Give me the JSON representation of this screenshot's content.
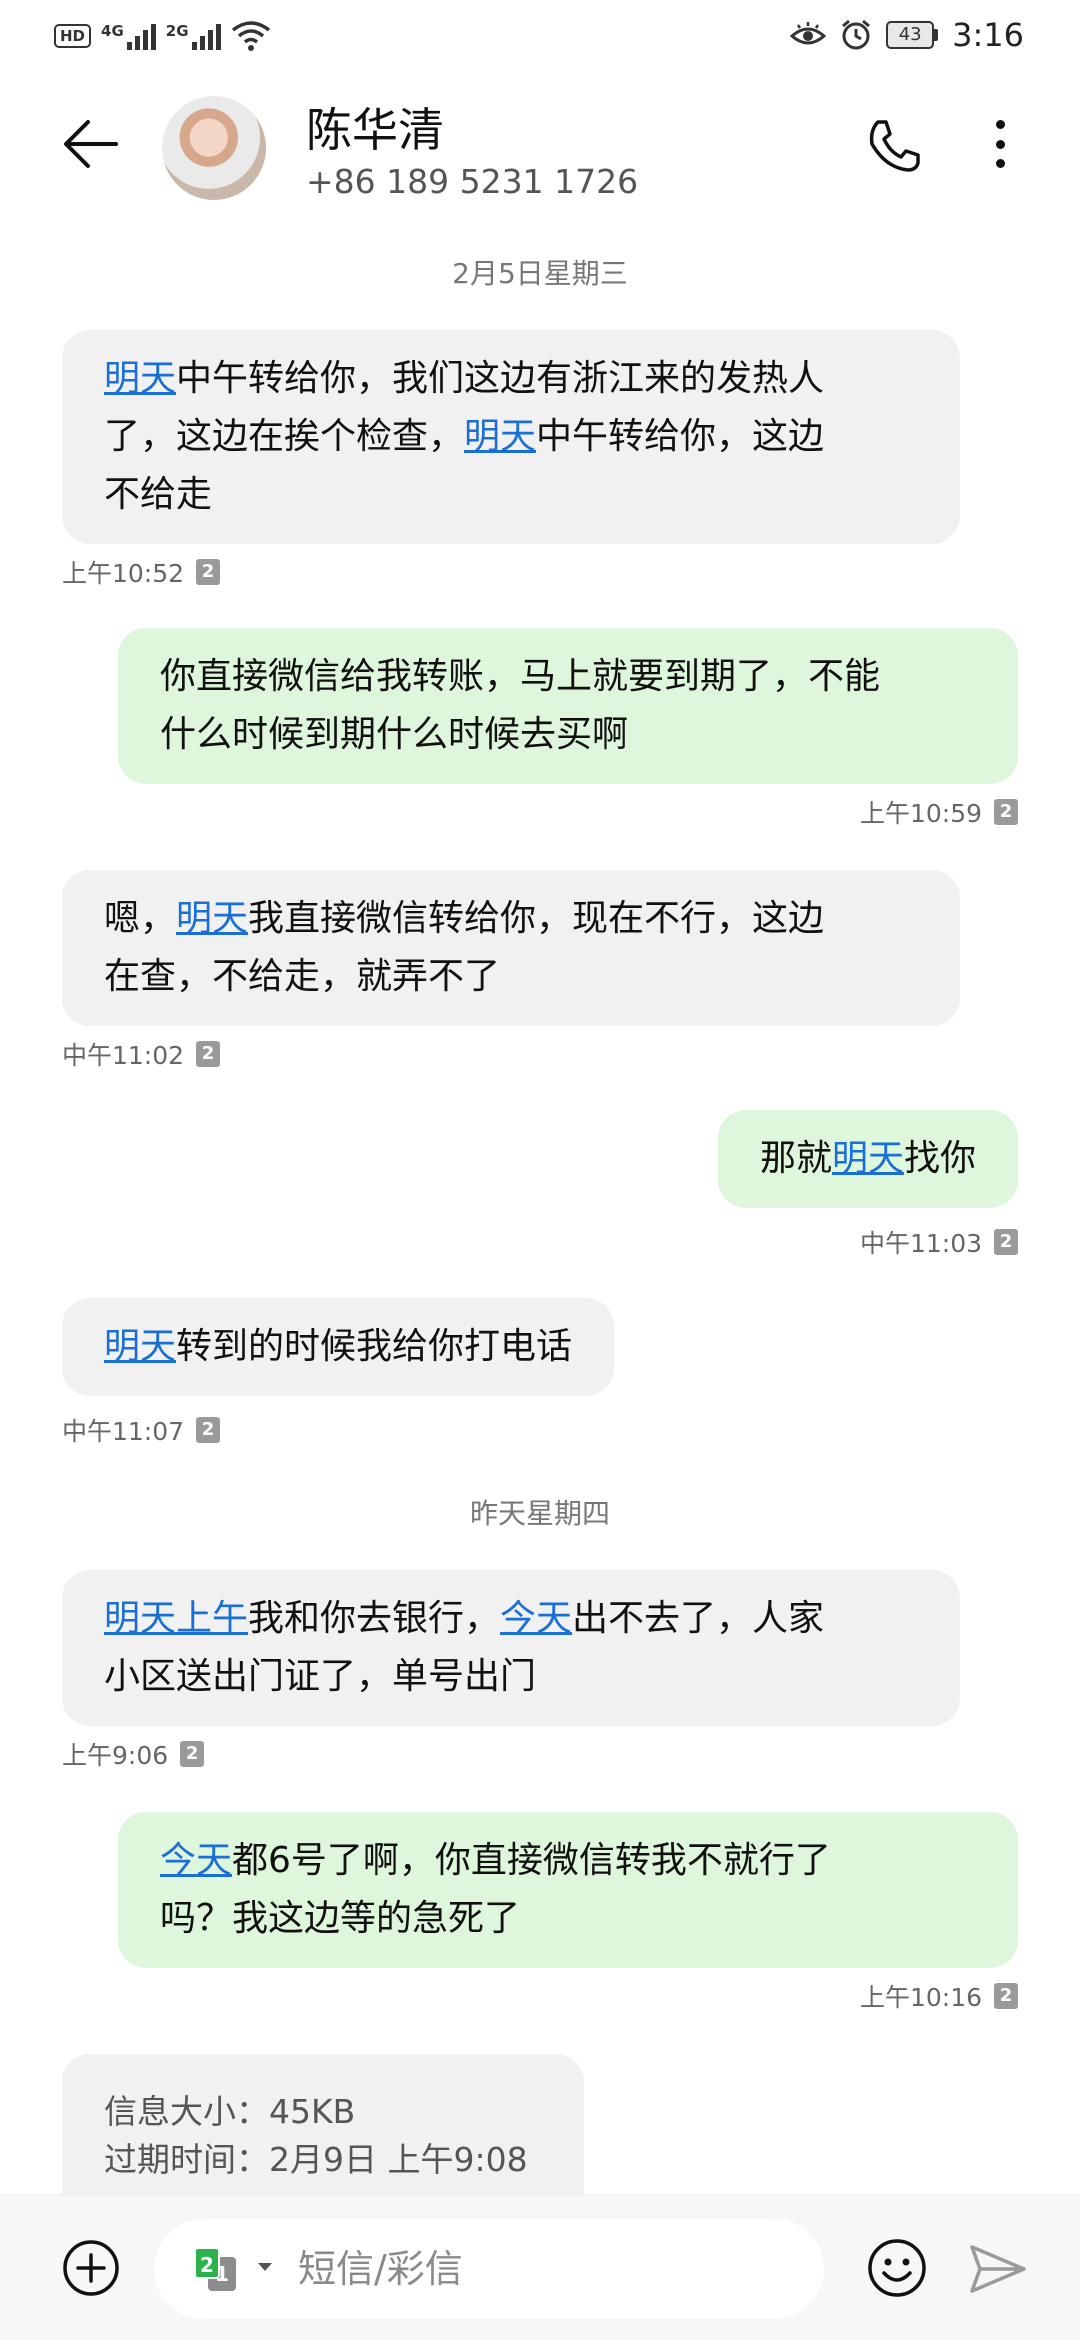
{
  "status_bar": {
    "hd": "HD",
    "net1": "4G",
    "net2": "2G",
    "battery": "43",
    "time": "3:16"
  },
  "header": {
    "name": "陈华清",
    "phone": "+86 189 5231 1726"
  },
  "conversation": {
    "date1": "2月5日星期三",
    "date2": "昨天星期四",
    "sim_label": "2",
    "messages": [
      {
        "dir": "in",
        "time": "上午10:52",
        "parts": [
          [
            "明天",
            true
          ],
          [
            "中午转给你，我们这边有浙江来的发热人",
            false
          ],
          [
            "\n",
            false
          ],
          [
            "了，这边在挨个检查，",
            false
          ],
          [
            "明天",
            true
          ],
          [
            "中午转给你，这边",
            false
          ],
          [
            "\n",
            false
          ],
          [
            "不给走",
            false
          ]
        ]
      },
      {
        "dir": "out",
        "time": "上午10:59",
        "parts": [
          [
            "你直接微信给我转账，马上就要到期了，不能",
            false
          ],
          [
            "\n",
            false
          ],
          [
            "什么时候到期什么时候去买啊",
            false
          ]
        ]
      },
      {
        "dir": "in",
        "time": "中午11:02",
        "parts": [
          [
            "嗯，",
            false
          ],
          [
            "明天",
            true
          ],
          [
            "我直接微信转给你，现在不行，这边",
            false
          ],
          [
            "\n",
            false
          ],
          [
            "在查，不给走，就弄不了",
            false
          ]
        ]
      },
      {
        "dir": "out",
        "time": "中午11:03",
        "parts": [
          [
            "那就",
            false
          ],
          [
            "明天",
            true
          ],
          [
            "找你",
            false
          ]
        ]
      },
      {
        "dir": "in",
        "time": "中午11:07",
        "parts": [
          [
            "明天",
            true
          ],
          [
            "转到的时候我给你打电话",
            false
          ]
        ]
      },
      {
        "dir": "in",
        "time": "上午9:06",
        "parts": [
          [
            "明天上午",
            true
          ],
          [
            "我和你去银行，",
            false
          ],
          [
            "今天",
            true
          ],
          [
            "出不去了，人家",
            false
          ],
          [
            "\n",
            false
          ],
          [
            "小区送出门证了，单号出门",
            false
          ]
        ]
      },
      {
        "dir": "out",
        "time": "上午10:16",
        "parts": [
          [
            "今天",
            true
          ],
          [
            "都6号了啊，你直接微信转我不就行了",
            false
          ],
          [
            "\n",
            false
          ],
          [
            "吗？我这边等的急死了",
            false
          ]
        ]
      }
    ],
    "mms": {
      "size": "信息大小：45KB",
      "expiry": "过期时间：2月9日 上午9:08"
    }
  },
  "input_bar": {
    "placeholder": "短信/彩信",
    "sim_front": "2",
    "sim_back": "1"
  },
  "icons": {
    "back": "arrow-left-icon",
    "call": "phone-icon",
    "more": "more-vertical-icon",
    "add": "plus-circle-icon",
    "emoji": "smiley-icon",
    "send": "send-icon",
    "eye": "eye-icon",
    "alarm": "alarm-icon",
    "wifi": "wifi-icon"
  },
  "colors": {
    "incoming_bubble": "#f1f1f1",
    "outgoing_bubble": "#def6dc",
    "link": "#1a6fd6",
    "sim_green": "#2cb24a"
  }
}
